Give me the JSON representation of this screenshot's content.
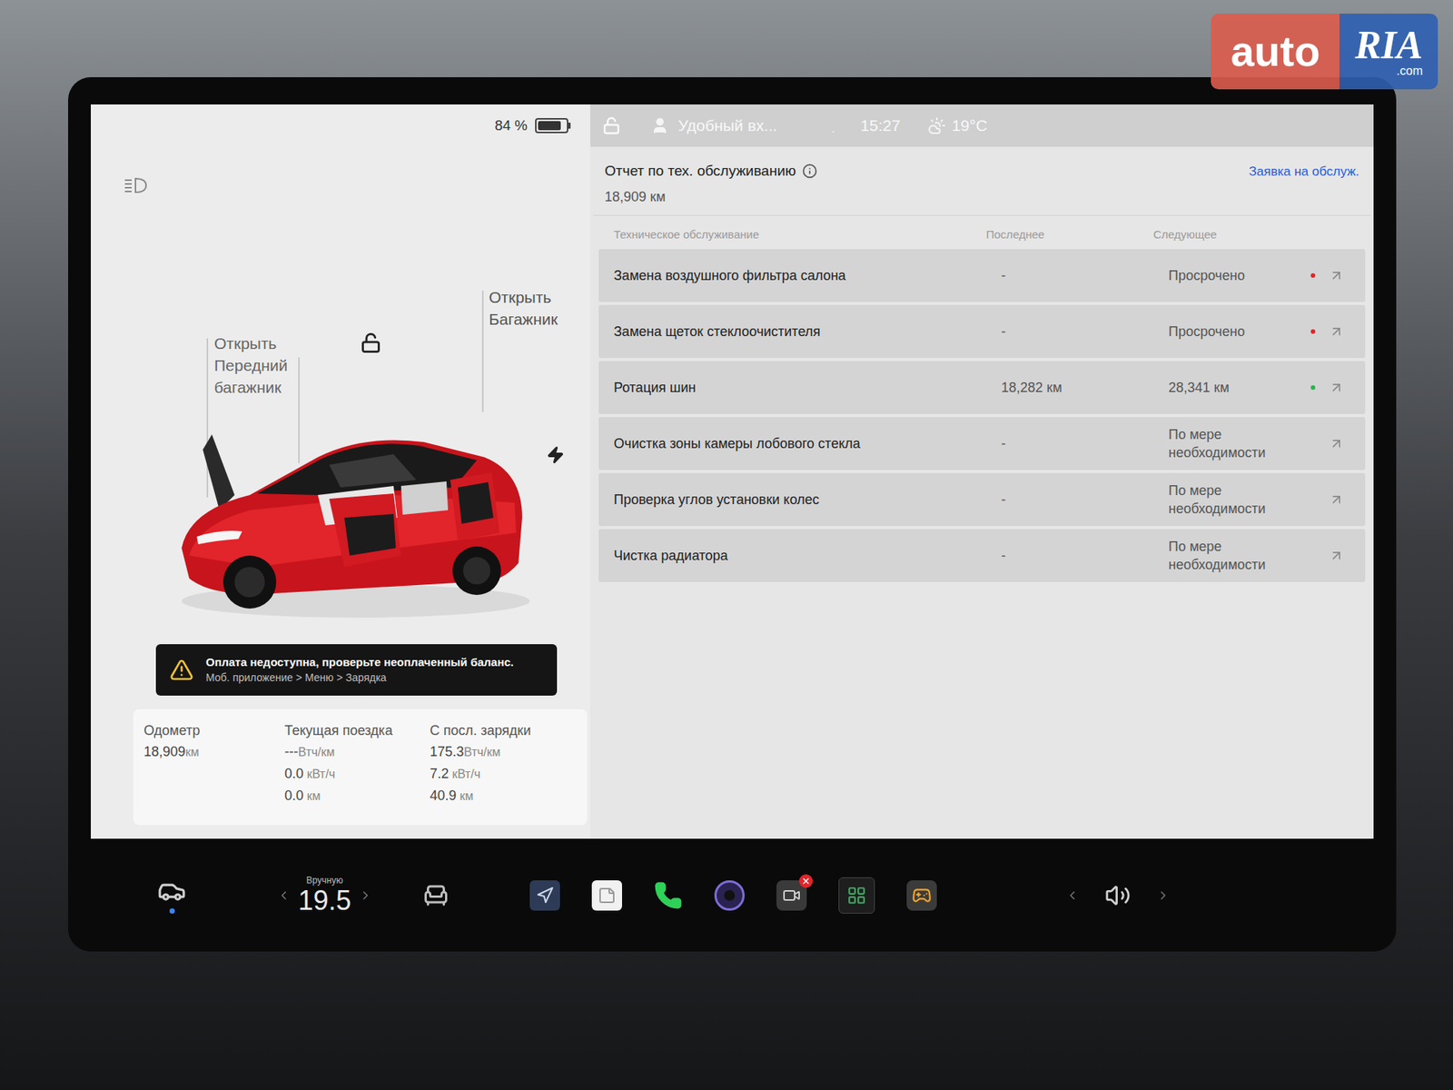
{
  "watermark": {
    "brand": "auto",
    "brand2": "RIA",
    "suffix": ".com"
  },
  "status": {
    "battery": "84 %",
    "battery_level": 0.84,
    "locked": false,
    "profile": "Удобный вх...",
    "time": "15:27",
    "temperature": "19°C"
  },
  "car": {
    "frunk_label": [
      "Открыть",
      "Передний",
      "багажник"
    ],
    "trunk_label": [
      "Открыть",
      "Багажник"
    ],
    "locked": false
  },
  "alert": {
    "title": "Оплата недоступна, проверьте неоплаченный баланс.",
    "path": "Моб. приложение > Меню > Зарядка"
  },
  "stats": [
    {
      "label": "Одометр",
      "lines": [
        {
          "value": "18,909",
          "unit": "км"
        }
      ]
    },
    {
      "label": "Текущая поездка",
      "lines": [
        {
          "value": "---",
          "unit": "Втч/км"
        },
        {
          "value": "0.0",
          "unit": " кВт/ч"
        },
        {
          "value": "0.0",
          "unit": " км"
        }
      ]
    },
    {
      "label": "С посл. зарядки",
      "lines": [
        {
          "value": "175.3",
          "unit": "Втч/км"
        },
        {
          "value": "7.2",
          "unit": " кВт/ч"
        },
        {
          "value": "40.9",
          "unit": " км"
        }
      ]
    }
  ],
  "report": {
    "title": "Отчет по тех. обслуживанию",
    "odometer": "18,909 км",
    "link": "Заявка на обслуж.",
    "columns": [
      "Техническое обслуживание",
      "Последнее",
      "Следующее"
    ],
    "rows": [
      {
        "name": "Замена воздушного фильтра салона",
        "last": "-",
        "next": "Просрочено",
        "color": "#e0252b"
      },
      {
        "name": "Замена щеток стеклоочистителя",
        "last": "-",
        "next": "Просрочено",
        "color": "#e0252b"
      },
      {
        "name": "Ротация шин",
        "last": "18,282 км",
        "next": "28,341 км",
        "color": "#2bb24c"
      },
      {
        "name": "Очистка зоны камеры лобового стекла",
        "last": "-",
        "next": "По мере необходимости",
        "color": null
      },
      {
        "name": "Проверка углов установки колес",
        "last": "-",
        "next": "По мере необходимости",
        "color": null
      },
      {
        "name": "Чистка радиатора",
        "last": "-",
        "next": "По мере необходимости",
        "color": null
      }
    ]
  },
  "taskbar": {
    "climate_mode": "Вручную",
    "temperature": "19.5",
    "dashcam_error": true
  }
}
